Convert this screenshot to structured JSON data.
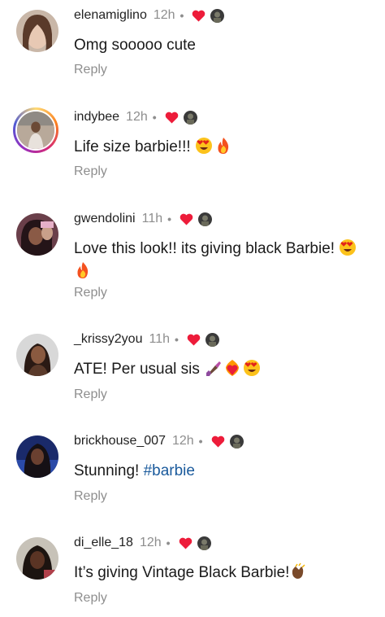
{
  "comments": [
    {
      "username": "elenamiglino",
      "time": "12h",
      "text": "Omg sooooo cute",
      "emojis": [],
      "reply_label": "Reply"
    },
    {
      "username": "indybee",
      "time": "12h",
      "text": "Life size barbie!!!",
      "emojis": [
        "heart-eyes-emoji",
        "fire-emoji"
      ],
      "reply_label": "Reply"
    },
    {
      "username": "gwendolini",
      "time": "11h",
      "text": "Love this look!! its giving black Barbie!",
      "emojis": [
        "heart-eyes-emoji",
        "fire-emoji"
      ],
      "reply_label": "Reply"
    },
    {
      "username": "_krissy2you",
      "time": "11h",
      "text": "ATE! Per usual sis",
      "emojis": [
        "nail-polish-emoji",
        "heart-on-fire-emoji",
        "heart-eyes-emoji"
      ],
      "reply_label": "Reply"
    },
    {
      "username": "brickhouse_007",
      "time": "12h",
      "text": "Stunning!",
      "hashtag": "#barbie",
      "emojis": [],
      "reply_label": "Reply"
    },
    {
      "username": "di_elle_18",
      "time": "12h",
      "text": "It’s giving Vintage Black Barbie!",
      "emojis": [
        "clapping-hands-emoji"
      ],
      "reply_label": "Reply"
    }
  ],
  "colors": {
    "heart": "#ed1c3a",
    "meta_gray": "#8e8e8e",
    "hashtag": "#1a5a9c"
  }
}
